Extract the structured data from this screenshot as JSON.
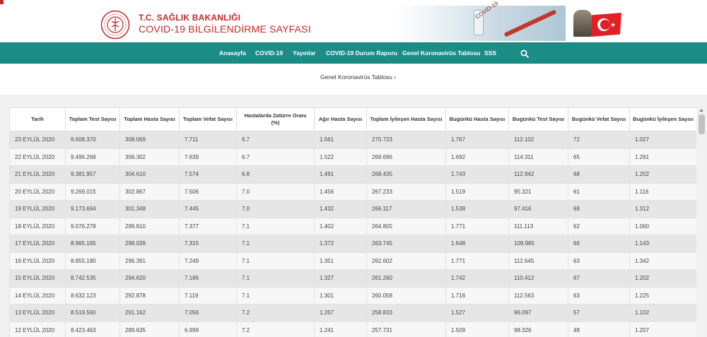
{
  "header": {
    "title_line1": "T.C. SAĞLIK BAKANLIĞI",
    "title_line2": "COVID-19 BİLGİLENDİRME SAYFASI",
    "hero_text": "COVID-19"
  },
  "nav": {
    "items": [
      "Anasayfa",
      "COVID-19",
      "Yayınlar",
      "COVID-19 Durum Raporu",
      "Genel Koronavirüs Tablosu",
      "SSS"
    ]
  },
  "breadcrumb": "Genel Koronavirüs Tablosu ›",
  "table": {
    "headers": [
      "Tarih",
      "Toplam Test Sayısı",
      "Toplam Hasta Sayısı",
      "Toplam Vefat Sayısı",
      "Hastalarda Zatürre Oranı (%)",
      "Ağır Hasta Sayısı",
      "Toplam İyileşen Hasta Sayısı",
      "Bugünkü Hasta Sayısı",
      "Bugünkü Test Sayısı",
      "Bugünkü Vefat Sayısı",
      "Bugünkü İyileşen Sayısı"
    ],
    "rows": [
      [
        "23 EYLÜL 2020",
        "9.608.370",
        "308.069",
        "7.711",
        "6.7",
        "1.561",
        "270.723",
        "1.767",
        "112.102",
        "72",
        "1.027"
      ],
      [
        "22 EYLÜL 2020",
        "9.496.268",
        "306.302",
        "7.639",
        "6.7",
        "1.522",
        "269.696",
        "1.692",
        "114.311",
        "65",
        "1.261"
      ],
      [
        "21 EYLÜL 2020",
        "9.381.957",
        "304.610",
        "7.574",
        "6.8",
        "1.491",
        "268.435",
        "1.743",
        "112.942",
        "68",
        "1.202"
      ],
      [
        "20 EYLÜL 2020",
        "9.269.015",
        "302.867",
        "7.506",
        "7.0",
        "1.456",
        "267.233",
        "1.519",
        "95.321",
        "61",
        "1.116"
      ],
      [
        "19 EYLÜL 2020",
        "9.173.694",
        "301.348",
        "7.445",
        "7.0",
        "1.432",
        "266.117",
        "1.538",
        "97.416",
        "68",
        "1.312"
      ],
      [
        "18 EYLÜL 2020",
        "9.076.278",
        "299.810",
        "7.377",
        "7.1",
        "1.402",
        "264.805",
        "1.771",
        "111.113",
        "62",
        "1.060"
      ],
      [
        "17 EYLÜL 2020",
        "8.965.165",
        "298.039",
        "7.315",
        "7.1",
        "1.372",
        "263.745",
        "1.648",
        "109.985",
        "66",
        "1.143"
      ],
      [
        "16 EYLÜL 2020",
        "8.855.180",
        "296.391",
        "7.249",
        "7.1",
        "1.351",
        "262.602",
        "1.771",
        "112.645",
        "63",
        "1.342"
      ],
      [
        "15 EYLÜL 2020",
        "8.742.535",
        "294.620",
        "7.186",
        "7.1",
        "1.327",
        "261.260",
        "1.742",
        "110.412",
        "67",
        "1.202"
      ],
      [
        "14 EYLÜL 2020",
        "8.632.123",
        "292.878",
        "7.119",
        "7.1",
        "1.301",
        "260.058",
        "1.716",
        "112.563",
        "63",
        "1.225"
      ],
      [
        "13 EYLÜL 2020",
        "8.519.560",
        "291.162",
        "7.056",
        "7.2",
        "1.267",
        "258.833",
        "1.527",
        "96.097",
        "57",
        "1.102"
      ],
      [
        "12 EYLÜL 2020",
        "8.423.463",
        "289.635",
        "6.999",
        "7.2",
        "1.241",
        "257.731",
        "1.509",
        "98.326",
        "48",
        "1.207"
      ]
    ]
  },
  "colors": {
    "brand_red": "#c62828",
    "nav_teal": "#1c8c87"
  },
  "icons": [
    "ministry-logo-icon",
    "search-icon",
    "turkish-flag-icon",
    "portrait-icon"
  ]
}
